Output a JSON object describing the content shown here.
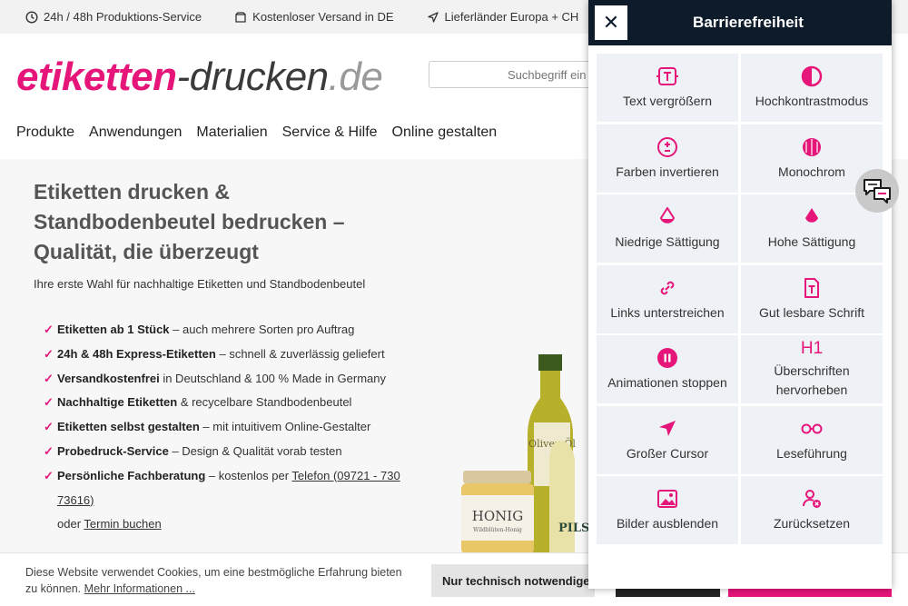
{
  "topbar": {
    "items": [
      {
        "icon": "clock-icon",
        "label": "24h / 48h Produktions-Service"
      },
      {
        "icon": "package-icon",
        "label": "Kostenloser Versand in DE"
      },
      {
        "icon": "location-arrow-icon",
        "label": "Lieferländer Europa + CH"
      }
    ]
  },
  "header": {
    "logo": {
      "part1": "etiketten",
      "part2": "-drucken",
      "part3": ".de"
    },
    "search_placeholder": "Suchbegriff ein",
    "nav": [
      "Produkte",
      "Anwendungen",
      "Materialien",
      "Service & Hilfe",
      "Online gestalten"
    ]
  },
  "hero": {
    "title": "Etiketten drucken & Standbodenbeutel bedrucken – Qualität, die überzeugt",
    "subtitle": "Ihre erste Wahl für nachhaltige Etiketten und Standbodenbeutel",
    "checks": [
      {
        "bold": "Etiketten ab 1 Stück",
        "rest": " – auch mehrere Sorten pro Auftrag"
      },
      {
        "bold": "24h & 48h Express-Etiketten",
        "rest": " – schnell & zuverlässig geliefert"
      },
      {
        "bold": "Versandkostenfrei",
        "rest": " in Deutschland & 100 % Made in Germany"
      },
      {
        "bold": "Nachhaltige Etiketten",
        "rest": " & recycelbare Standbodenbeutel"
      },
      {
        "bold": "Etiketten selbst gestalten",
        "rest": " – mit intuitivem Online-Gestalter"
      },
      {
        "bold": "Probedruck-Service",
        "rest": " – Design & Qualität vorab testen"
      }
    ],
    "last_check": {
      "bold": "Persönliche Fachberatung",
      "rest": " – kostenlos per ",
      "phone_link_part1": "Telefon (09721 - 730",
      "phone_link_part2": "73616)",
      "or_text": "oder ",
      "appointment_link": "Termin buchen"
    },
    "product_labels": {
      "honey": "HONIG",
      "honey_sub": "Wildblüten-Honig",
      "oil": "Oliven Öl",
      "beer": "PILSN"
    }
  },
  "cookie": {
    "text": "Diese Website verwendet Cookies, um eine bestmögliche Erfahrung bieten zu können.",
    "more_link": "Mehr Informationen ...",
    "btn_technical": "Nur technisch notwendige"
  },
  "a11y": {
    "title": "Barrierefreiheit",
    "close_label": "✕",
    "tiles": [
      {
        "id": "text-enlarge",
        "label": "Text vergrößern",
        "icon": "text-size-icon"
      },
      {
        "id": "high-contrast",
        "label": "Hochkontrastmodus",
        "icon": "contrast-icon"
      },
      {
        "id": "invert-colors",
        "label": "Farben invertieren",
        "icon": "invert-icon"
      },
      {
        "id": "monochrome",
        "label": "Monochrom",
        "icon": "monochrome-icon"
      },
      {
        "id": "low-saturation",
        "label": "Niedrige Sättigung",
        "icon": "drop-half-icon"
      },
      {
        "id": "high-saturation",
        "label": "Hohe Sättigung",
        "icon": "drop-icon"
      },
      {
        "id": "underline-links",
        "label": "Links unterstreichen",
        "icon": "link-icon"
      },
      {
        "id": "readable-font",
        "label": "Gut lesbare Schrift",
        "icon": "font-icon"
      },
      {
        "id": "stop-animations",
        "label": "Animationen stoppen",
        "icon": "pause-icon"
      },
      {
        "id": "highlight-headings",
        "label": "Überschriften hervorheben",
        "icon": "h1-icon",
        "icon_text": "H1"
      },
      {
        "id": "big-cursor",
        "label": "Großer Cursor",
        "icon": "cursor-icon"
      },
      {
        "id": "reading-guide",
        "label": "Leseführung",
        "icon": "glasses-icon"
      },
      {
        "id": "hide-images",
        "label": "Bilder ausblenden",
        "icon": "image-icon"
      },
      {
        "id": "reset",
        "label": "Zurücksetzen",
        "icon": "reset-user-icon"
      }
    ]
  },
  "colors": {
    "brand": "#e6157a",
    "panel_header": "#0d1b2a",
    "tile_bg": "#eef1f5"
  }
}
